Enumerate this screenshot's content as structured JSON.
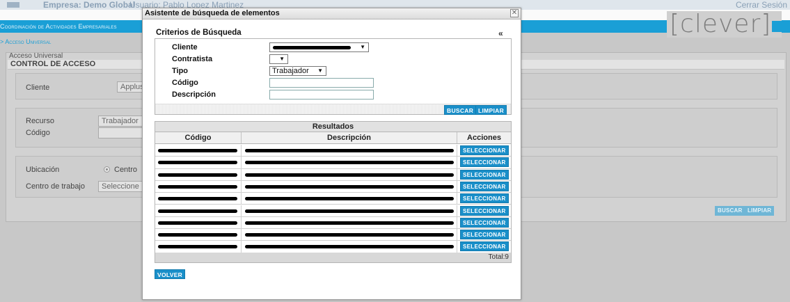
{
  "app": {
    "empresa_label": "Empresa: Demo Global",
    "usuario_label": "Usuario: Pablo Lopez Martinez",
    "logout": "Cerrar Sesión",
    "nav_title": "Coordinación de Actividades Empresariales",
    "logo_word": "[clever]",
    "breadcrumb": "> Acceso Universal"
  },
  "background_page": {
    "panel_title": "Acceso Universal",
    "section_header": "CONTROL DE ACCESO",
    "cliente_label": "Cliente",
    "cliente_value": "Applus E",
    "recurso_label": "Recurso",
    "recurso_value": "Trabajador",
    "codigo_label": "Código",
    "ubicacion_label": "Ubicación",
    "ubicacion_option": "Centro",
    "centro_label": "Centro de trabajo",
    "centro_value": "Seleccione",
    "buscar": "Buscar",
    "limpiar": "Limpiar"
  },
  "dialog": {
    "title": "Asistente de búsqueda de elementos",
    "close_glyph": "✕",
    "criteria_title": "Criterios de Búsqueda",
    "collapse_glyph": "«",
    "fields": {
      "cliente": "Cliente",
      "contratista": "Contratista",
      "tipo": "Tipo",
      "tipo_value": "Trabajador",
      "codigo": "Código",
      "descripcion": "Descripción"
    },
    "buscar": "Buscar",
    "limpiar": "Limpiar",
    "results": {
      "title": "Resultados",
      "columns": [
        "Código",
        "Descripción",
        "Acciones"
      ],
      "action_label": "Seleccionar",
      "total_text": "Total:9"
    },
    "volver": "Volver"
  },
  "colors": {
    "accent": "#1a9fd6",
    "button": "#1a8fc9"
  }
}
